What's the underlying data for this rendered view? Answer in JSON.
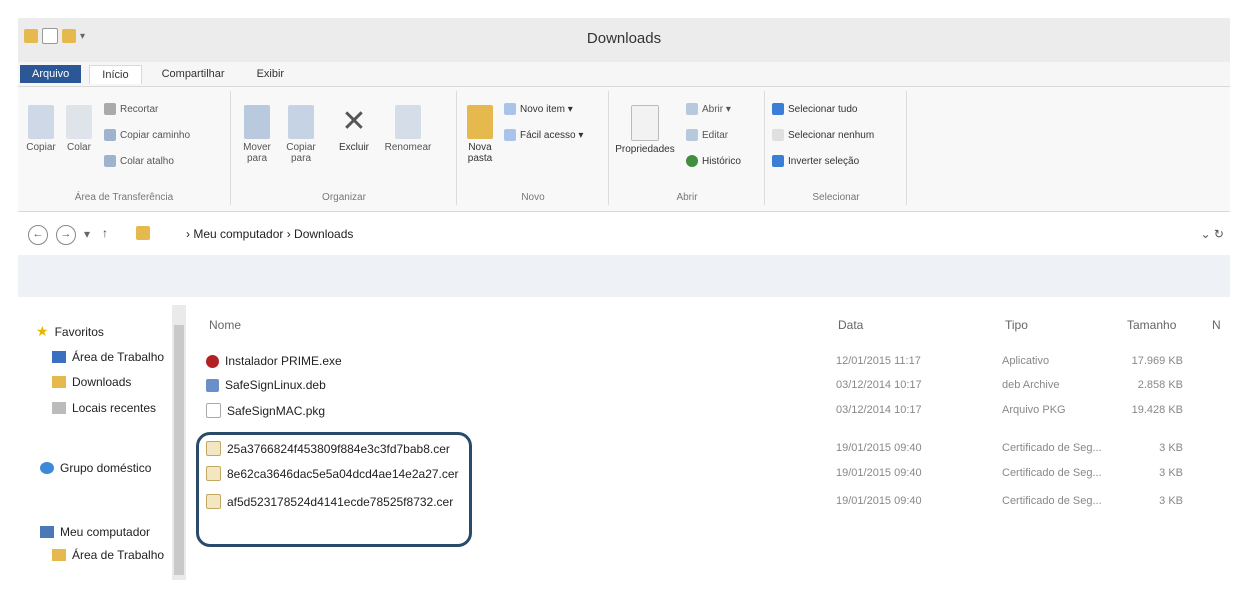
{
  "window": {
    "title": "Downloads"
  },
  "ribbon_tabs": [
    "Arquivo",
    "Início",
    "Compartilhar",
    "Exibir"
  ],
  "ribbon": {
    "clipboard": {
      "label": "Área de Transferência",
      "copy": "Copiar",
      "paste": "Colar",
      "cut": "Recortar",
      "copy_path": "Copiar caminho",
      "paste_shortcut": "Colar atalho"
    },
    "organize": {
      "label": "Organizar",
      "move": "Mover para",
      "copy_to": "Copiar para",
      "delete": "Excluir",
      "rename": "Renomear"
    },
    "new": {
      "label": "Novo",
      "new_folder": "Nova pasta",
      "new_item": "Novo item ▾",
      "easy_access": "Fácil acesso ▾"
    },
    "open": {
      "label": "Abrir",
      "properties": "Propriedades",
      "open_btn": "Abrir ▾",
      "edit": "Editar",
      "history": "Histórico"
    },
    "select": {
      "label": "Selecionar",
      "select_all": "Selecionar tudo",
      "select_none": "Selecionar nenhum",
      "invert": "Inverter seleção"
    }
  },
  "address": {
    "back": "←",
    "forward": "→",
    "down": "▾",
    "up": "↑",
    "crumb": "› Meu computador › Downloads",
    "right": "⌄ ↻"
  },
  "sidebar": {
    "favorites": "Favoritos",
    "items": [
      "Área de Trabalho",
      "Downloads",
      "Locais recentes"
    ],
    "homegroup": "Grupo doméstico",
    "computer": "Meu computador",
    "computer_items": [
      "Área de Trabalho"
    ]
  },
  "columns": {
    "name": "Nome",
    "date": "Data",
    "type": "Tipo",
    "size": "Tamanho",
    "extra": "N"
  },
  "files": [
    {
      "name": "Instalador PRIME.exe",
      "date": "12/01/2015 11:17",
      "type": "Aplicativo",
      "size": "17.969 KB",
      "icon": "app-icon"
    },
    {
      "name": "SafeSignLinux.deb",
      "date": "03/12/2014 10:17",
      "type": "deb Archive",
      "size": "2.858 KB",
      "icon": "archive-icon"
    },
    {
      "name": "SafeSignMAC.pkg",
      "date": "03/12/2014 10:17",
      "type": "Arquivo PKG",
      "size": "19.428 KB",
      "icon": "file-icon"
    },
    {
      "name": "25a3766824f453809f884e3c3fd7bab8.cer",
      "date": "19/01/2015 09:40",
      "type": "Certificado de Seg...",
      "size": "3 KB",
      "icon": "certificate-icon"
    },
    {
      "name": "8e62ca3646dac5e5a04dcd4ae14e2a27.cer",
      "date": "19/01/2015 09:40",
      "type": "Certificado de Seg...",
      "size": "3 KB",
      "icon": "certificate-icon"
    },
    {
      "name": "af5d523178524d4141ecde78525f8732.cer",
      "date": "19/01/2015 09:40",
      "type": "Certificado de Seg...",
      "size": "3 KB",
      "icon": "certificate-icon"
    }
  ],
  "colors": {
    "file_tab": "#2b5797",
    "highlight": "#2a4a6a"
  }
}
